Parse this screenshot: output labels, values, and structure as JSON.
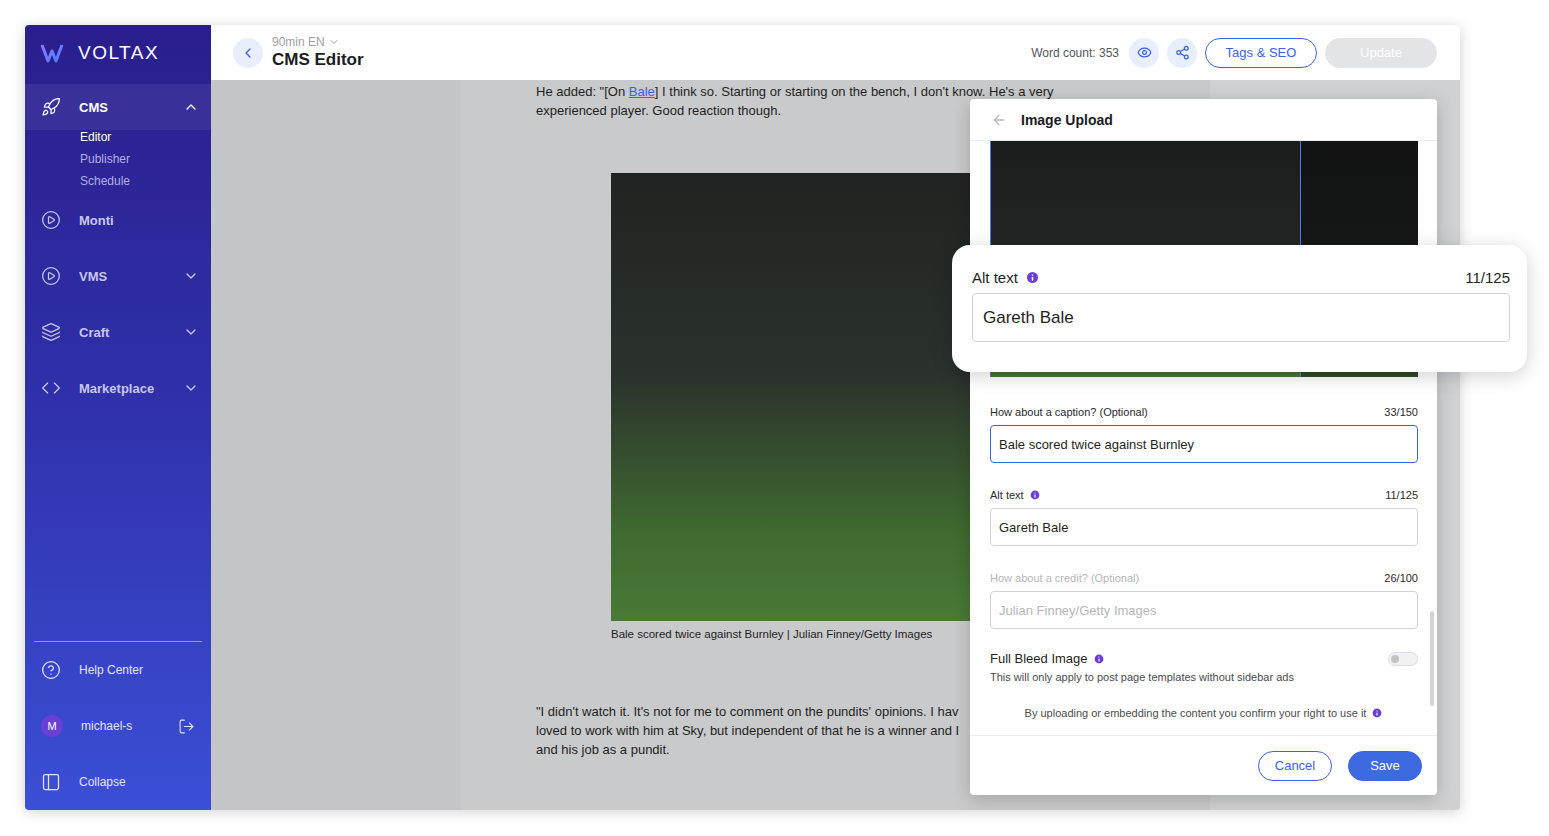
{
  "sidebar": {
    "logo": "VOLTAX",
    "sections": [
      {
        "label": "CMS",
        "expandable": true,
        "expanded": true,
        "items": [
          {
            "label": "Editor",
            "selected": true
          },
          {
            "label": "Publisher",
            "selected": false
          },
          {
            "label": "Schedule",
            "selected": false
          }
        ]
      },
      {
        "label": "Monti",
        "expandable": false,
        "expanded": false,
        "items": []
      },
      {
        "label": "VMS",
        "expandable": true,
        "expanded": false,
        "items": []
      },
      {
        "label": "Craft",
        "expandable": true,
        "expanded": false,
        "items": []
      },
      {
        "label": "Marketplace",
        "expandable": true,
        "expanded": false,
        "items": []
      }
    ],
    "footer": {
      "help": "Help Center",
      "user": {
        "initial": "M",
        "name": "michael-s"
      },
      "collapse": "Collapse"
    }
  },
  "header": {
    "site": "90min EN",
    "title": "CMS Editor",
    "word_count": "Word count: 353",
    "buttons": [
      {
        "label": "Tags & SEO",
        "disabled": false
      },
      {
        "label": "Update",
        "disabled": true
      }
    ]
  },
  "article": {
    "paragraph1": [
      [
        {
          "text": "He added: \"[On ",
          "link": false
        },
        {
          "text": "Bale",
          "link": true
        },
        {
          "text": "] I think so. Starting or starting on the bench, I don't know. He's a very",
          "link": false
        }
      ],
      [
        {
          "text": "experienced player. Good reaction though.",
          "link": false
        }
      ]
    ],
    "image_caption": "Bale scored twice against Burnley | Julian Finney/Getty Images",
    "paragraph2": [
      "\"I didn't watch it. It's not for me to comment on the pundits' opinions. I hav",
      "loved to work with him at Sky, but independent of that he is a winner and I",
      "and his job as a pundit."
    ]
  },
  "modal": {
    "title": "Image Upload",
    "fields": [
      {
        "label": "How about a caption? (Optional)",
        "count": "33/150",
        "value": "Bale scored twice against Burnley",
        "placeholder": "",
        "info": false,
        "focused": true,
        "disabled": false
      },
      {
        "label": "Alt text",
        "count": "11/125",
        "value": "Gareth Bale",
        "placeholder": "",
        "info": true,
        "focused": false,
        "disabled": false
      },
      {
        "label": "How about a credit? (Optional)",
        "count": "26/100",
        "value": "",
        "placeholder": "Julian Finney/Getty Images",
        "info": false,
        "focused": false,
        "disabled": true
      }
    ],
    "full_bleed": {
      "label": "Full Bleed Image",
      "on": false,
      "description": "This will only apply to post page templates without sidebar ads"
    },
    "disclaimer": "By uploading or embedding the content you confirm your right to use it",
    "buttons": [
      {
        "label": "Cancel",
        "primary": false
      },
      {
        "label": "Save",
        "primary": true
      }
    ]
  },
  "callout": {
    "label": "Alt text",
    "count": "11/125",
    "value": "Gareth Bale"
  }
}
